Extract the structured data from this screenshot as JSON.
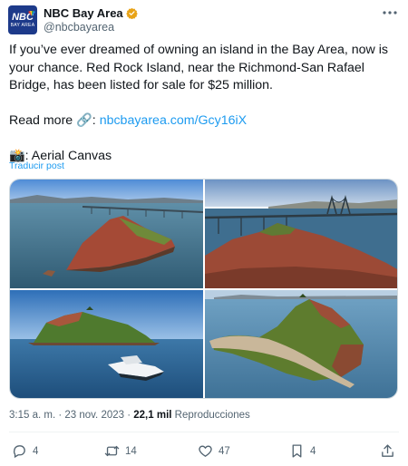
{
  "author": {
    "name": "NBC Bay Area",
    "handle": "@nbcbayarea",
    "avatar": {
      "logo_text": "NBC",
      "logo_subtext": "BAY AREA",
      "color": "#1d3a8a"
    },
    "verified_badge_color": "#e8a317"
  },
  "tweet": {
    "paragraph_1": "If you’ve ever dreamed of owning an island in the Bay Area, now is your chance. Red Rock Island, near the Richmond-San Rafael Bridge, has been listed for sale for $25 million.",
    "read_more_prefix": "Read more ",
    "link_emoji": "🔗",
    "link_text": "nbcbayarea.com/Gcy16iX",
    "credit_emoji": "📸",
    "credit_text": ": Aerial Canvas",
    "translate_label": "Traducir post"
  },
  "media": {
    "photos": [
      {
        "alt": "red-rock-island-with-bridge-wide"
      },
      {
        "alt": "red-rock-island-bridge-closeup"
      },
      {
        "alt": "red-rock-island-with-boat"
      },
      {
        "alt": "red-rock-island-beach-aerial"
      }
    ]
  },
  "meta": {
    "time": "3:15 a. m.",
    "separator": " · ",
    "date": "23 nov. 2023",
    "views_count": "22,1 mil",
    "views_label": "Reproducciones"
  },
  "actions": {
    "replies": "4",
    "reposts": "14",
    "likes": "47",
    "bookmarks": "4"
  },
  "colors": {
    "link": "#1d9bf0",
    "secondary_text": "#536471",
    "primary_text": "#0f1419"
  }
}
